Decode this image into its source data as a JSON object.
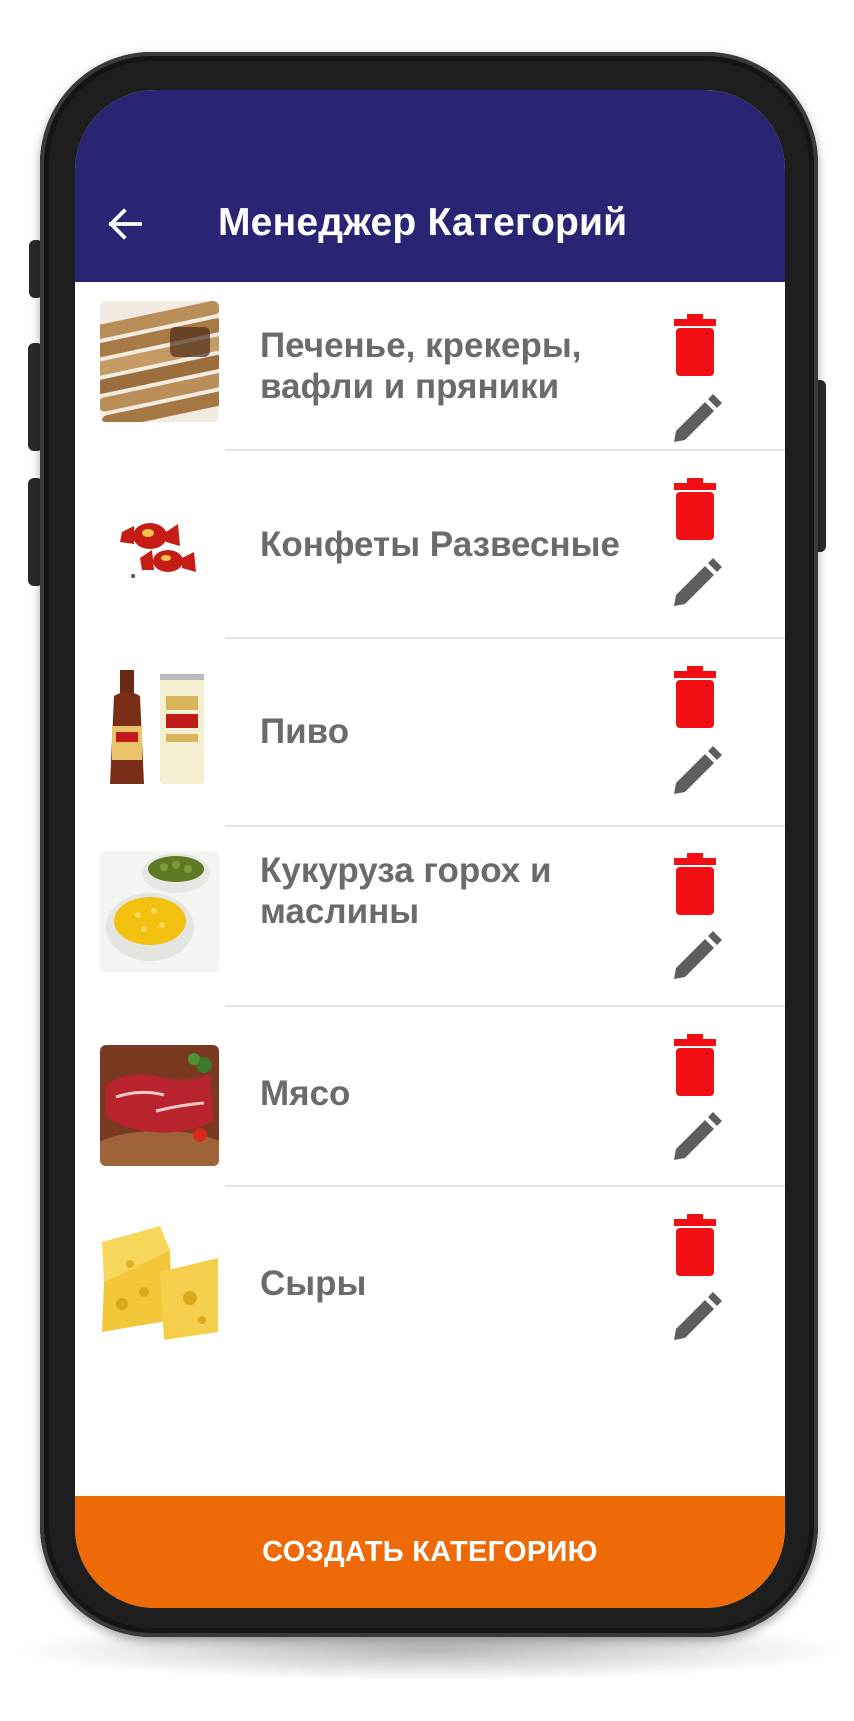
{
  "app_bar": {
    "title": "Менеджер Категорий",
    "back_icon": "arrow-left-icon",
    "background_color": "#2a2474"
  },
  "categories": [
    {
      "name": "Печенье, крекеры, вафли и пряники",
      "thumbnail": "wafer-rolls"
    },
    {
      "name": "Конфеты Развесные",
      "thumbnail": "wrapped-candies"
    },
    {
      "name": "Пиво",
      "thumbnail": "beer-bottle-and-can"
    },
    {
      "name": "Кукуруза горох и маслины",
      "thumbnail": "corn-and-peas-bowls"
    },
    {
      "name": "Мясо",
      "thumbnail": "raw-meat"
    },
    {
      "name": "Сыры",
      "thumbnail": "cheese"
    }
  ],
  "row_actions": {
    "delete_icon": "trash-icon",
    "edit_icon": "pencil-icon",
    "delete_color": "#f20f14",
    "edit_color": "#5e5e5e"
  },
  "footer": {
    "create_button_label": "СОЗДАТЬ КАТЕГОРИЮ",
    "button_color": "#ee6a07"
  }
}
